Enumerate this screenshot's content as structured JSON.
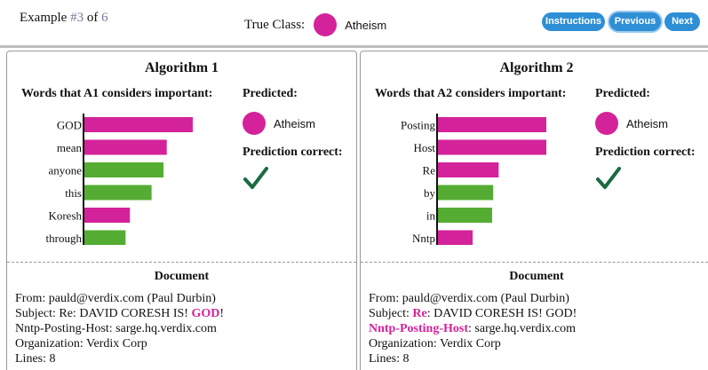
{
  "header": {
    "example_prefix": "Example ",
    "example_index": "#3",
    "example_of": " of ",
    "example_total": "6",
    "true_class_label": "True Class:",
    "true_class_value": "Atheism",
    "buttons": {
      "instructions": "Instructions",
      "previous": "Previous",
      "next": "Next"
    }
  },
  "colors": {
    "atheism": "#d4229a",
    "christian": "#54ad32",
    "button": "#2f8fd6",
    "check": "#1a6b43"
  },
  "panels": [
    {
      "title": "Algorithm 1",
      "words_title": "Words that A1 considers important:",
      "predicted_label": "Predicted:",
      "predicted_class": "Atheism",
      "correct_label": "Prediction correct:",
      "correct_icon": "checkmark-icon",
      "chart_data": {
        "type": "bar",
        "orientation": "horizontal",
        "categories": [
          "GOD",
          "mean",
          "anyone",
          "this",
          "Koresh",
          "through"
        ],
        "values": [
          1.0,
          0.76,
          0.73,
          0.62,
          0.42,
          0.38
        ],
        "colors": [
          "atheism",
          "atheism",
          "christian",
          "christian",
          "atheism",
          "christian"
        ]
      },
      "doc_title": "Document",
      "doc_lines": [
        [
          {
            "t": "From: pauld@verdix.com (Paul Durbin)",
            "h": false
          }
        ],
        [
          {
            "t": "Subject: Re: DAVID CORESH IS! ",
            "h": false
          },
          {
            "t": "GOD",
            "h": true
          },
          {
            "t": "!",
            "h": false
          }
        ],
        [
          {
            "t": "Nntp-Posting-Host: sarge.hq.verdix.com",
            "h": false
          }
        ],
        [
          {
            "t": "Organization: Verdix Corp",
            "h": false
          }
        ],
        [
          {
            "t": "Lines: 8",
            "h": false
          }
        ]
      ]
    },
    {
      "title": "Algorithm 2",
      "words_title": "Words that A2 considers important:",
      "predicted_label": "Predicted:",
      "predicted_class": "Atheism",
      "correct_label": "Prediction correct:",
      "correct_icon": "checkmark-icon",
      "chart_data": {
        "type": "bar",
        "orientation": "horizontal",
        "categories": [
          "Posting",
          "Host",
          "Re",
          "by",
          "in",
          "Nntp"
        ],
        "values": [
          1.0,
          1.0,
          0.56,
          0.51,
          0.5,
          0.32
        ],
        "colors": [
          "atheism",
          "atheism",
          "atheism",
          "christian",
          "christian",
          "atheism"
        ]
      },
      "doc_title": "Document",
      "doc_lines": [
        [
          {
            "t": "From: pauld@verdix.com (Paul Durbin)",
            "h": false
          }
        ],
        [
          {
            "t": "Subject: ",
            "h": false
          },
          {
            "t": "Re",
            "h": true
          },
          {
            "t": ": DAVID CORESH IS! GOD!",
            "h": false
          }
        ],
        [
          {
            "t": "Nntp-Posting-Host",
            "h": true
          },
          {
            "t": ": sarge.hq.verdix.com",
            "h": false
          }
        ],
        [
          {
            "t": "Organization: Verdix Corp",
            "h": false
          }
        ],
        [
          {
            "t": "Lines: 8",
            "h": false
          }
        ]
      ]
    }
  ]
}
